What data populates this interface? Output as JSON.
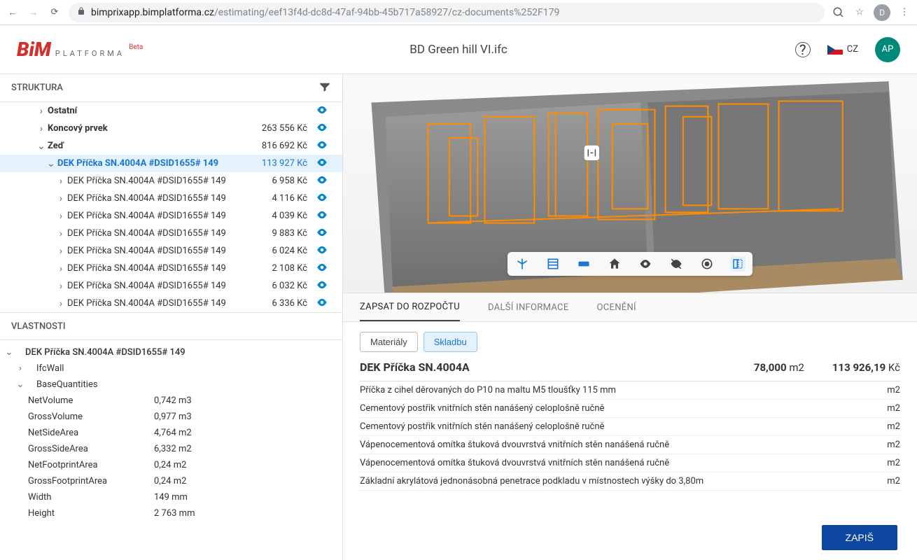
{
  "browser": {
    "url_host": "bimprixapp.bimplatforma.cz",
    "url_path": "/estimating/eef13f4d-dc8d-47af-94bb-45b717a58927/cz-documents%252F179",
    "avatar": "D"
  },
  "header": {
    "logo_brand": "BiM",
    "logo_text": "PLATFORMA",
    "beta": "Beta",
    "title": "BD Green hill VI.ifc",
    "lang": "CZ",
    "avatar": "AP"
  },
  "structure": {
    "title": "STRUKTURA",
    "rows": [
      {
        "label": "Ostatní",
        "price": "",
        "indent": 50,
        "chev": "›",
        "bold": true
      },
      {
        "label": "Koncový prvek",
        "price": "263 556 Kč",
        "indent": 50,
        "chev": "›",
        "bold": true
      },
      {
        "label": "Zeď",
        "price": "816 692 Kč",
        "indent": 50,
        "chev": "⌄",
        "bold": true
      },
      {
        "label": "DEK Příčka SN.4004A #DSID1655# 149",
        "price": "113 927 Kč",
        "indent": 64,
        "chev": "⌄",
        "selected": true,
        "bold": true
      },
      {
        "label": "DEK Příčka SN.4004A #DSID1655# 149",
        "price": "6 958 Kč",
        "indent": 78,
        "chev": "›"
      },
      {
        "label": "DEK Příčka SN.4004A #DSID1655# 149",
        "price": "4 116 Kč",
        "indent": 78,
        "chev": "›"
      },
      {
        "label": "DEK Příčka SN.4004A #DSID1655# 149",
        "price": "4 039 Kč",
        "indent": 78,
        "chev": "›"
      },
      {
        "label": "DEK Příčka SN.4004A #DSID1655# 149",
        "price": "9 883 Kč",
        "indent": 78,
        "chev": "›"
      },
      {
        "label": "DEK Příčka SN.4004A #DSID1655# 149",
        "price": "6 024 Kč",
        "indent": 78,
        "chev": "›"
      },
      {
        "label": "DEK Příčka SN.4004A #DSID1655# 149",
        "price": "2 108 Kč",
        "indent": 78,
        "chev": "›"
      },
      {
        "label": "DEK Příčka SN.4004A #DSID1655# 149",
        "price": "6 032 Kč",
        "indent": 78,
        "chev": "›"
      },
      {
        "label": "DEK Příčka SN.4004A #DSID1655# 149",
        "price": "6 336 Kč",
        "indent": 78,
        "chev": "›"
      }
    ]
  },
  "properties": {
    "title": "VLASTNOSTI",
    "group_title": "DEK Příčka SN.4004A #DSID1655# 149",
    "ifc": "IfcWall",
    "base_q": "BaseQuantities",
    "rows": [
      {
        "label": "NetVolume",
        "value": "0,742 m3"
      },
      {
        "label": "GrossVolume",
        "value": "0,977 m3"
      },
      {
        "label": "NetSideArea",
        "value": "4,764 m2"
      },
      {
        "label": "GrossSideArea",
        "value": "6,332 m2"
      },
      {
        "label": "NetFootprintArea",
        "value": "0,24 m2"
      },
      {
        "label": "GrossFootprintArea",
        "value": "0,24 m2"
      },
      {
        "label": "Width",
        "value": "149 mm"
      },
      {
        "label": "Height",
        "value": "2 763 mm"
      }
    ]
  },
  "detail": {
    "tabs": [
      "ZAPSAT DO ROZPOČTU",
      "DALŠÍ INFORMACE",
      "OCENĚNÍ"
    ],
    "btn_material": "Materiály",
    "btn_skladbu": "Skladbu",
    "name": "DEK Příčka SN.4004A",
    "quantity": "78,000",
    "unit": "m2",
    "total": "113 926,19",
    "currency": "Kč",
    "items": [
      {
        "desc": "Příčka z cihel děrovaných do P10 na maltu M5 tloušťky 115 mm",
        "unit": "m2"
      },
      {
        "desc": "Cementový postřik vnitřních stěn nanášený celoplošně ručně",
        "unit": "m2"
      },
      {
        "desc": "Cementový postřik vnitřních stěn nanášený celoplošně ručně",
        "unit": "m2"
      },
      {
        "desc": "Vápenocementová omítka štuková dvouvrstvá vnitřních stěn nanášená ručně",
        "unit": "m2"
      },
      {
        "desc": "Vápenocementová omítka štuková dvouvrstvá vnitřních stěn nanášená ručně",
        "unit": "m2"
      },
      {
        "desc": "Základní akrylátová jednonásobná penetrace podkladu v místnostech výšky do 3,80m",
        "unit": "m2"
      }
    ],
    "save": "ZAPIŠ"
  }
}
